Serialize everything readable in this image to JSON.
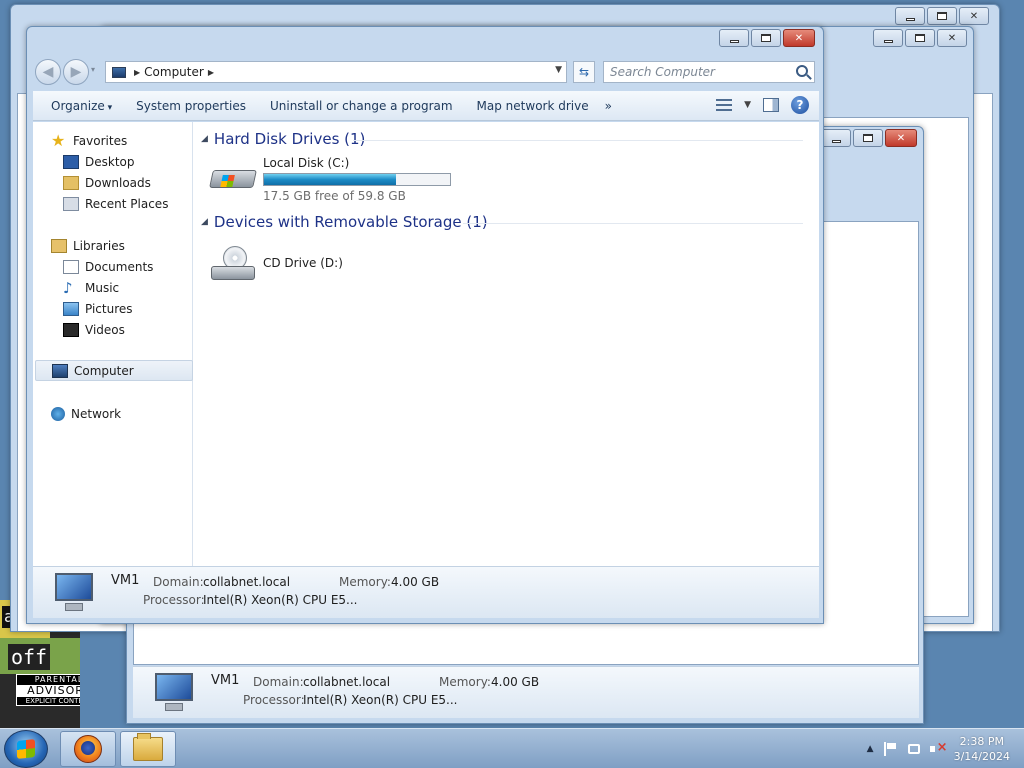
{
  "explorer": {
    "address_text": "Computer",
    "search_placeholder": "Search Computer",
    "toolbar": {
      "organize": "Organize",
      "system_properties": "System properties",
      "uninstall": "Uninstall or change a program",
      "map_network": "Map network drive",
      "more": "»"
    },
    "nav": {
      "favorites": "Favorites",
      "desktop": "Desktop",
      "downloads": "Downloads",
      "recent": "Recent Places",
      "libraries": "Libraries",
      "documents": "Documents",
      "music": "Music",
      "pictures": "Pictures",
      "videos": "Videos",
      "computer": "Computer",
      "network": "Network"
    },
    "groups": {
      "hdd_header": "Hard Disk Drives (1)",
      "removable_header": "Devices with Removable Storage (1)"
    },
    "drives": {
      "local_name": "Local Disk (C:)",
      "local_free": "17.5 GB free of 59.8 GB",
      "local_used_fraction": 0.707,
      "cd_name": "CD Drive (D:)"
    },
    "details": {
      "name": "VM1",
      "domain_label": "Domain:",
      "domain_value": "collabnet.local",
      "memory_label": "Memory:",
      "memory_value": "4.00 GB",
      "processor_label": "Processor:",
      "processor_value": "Intel(R) Xeon(R) CPU E5..."
    }
  },
  "desktop_art": {
    "tile_text": "a",
    "off_text": "off",
    "advisory_l1": "PARENTAL",
    "advisory_l2": "ADVISORY",
    "advisory_l3": "EXPLICIT CONTENT"
  },
  "taskbar": {
    "time": "2:38 PM",
    "date": "3/14/2024"
  },
  "colors": {
    "link_blue": "#1e3287",
    "toolbar_text": "#1e395b",
    "close_red": "#c0392b"
  }
}
